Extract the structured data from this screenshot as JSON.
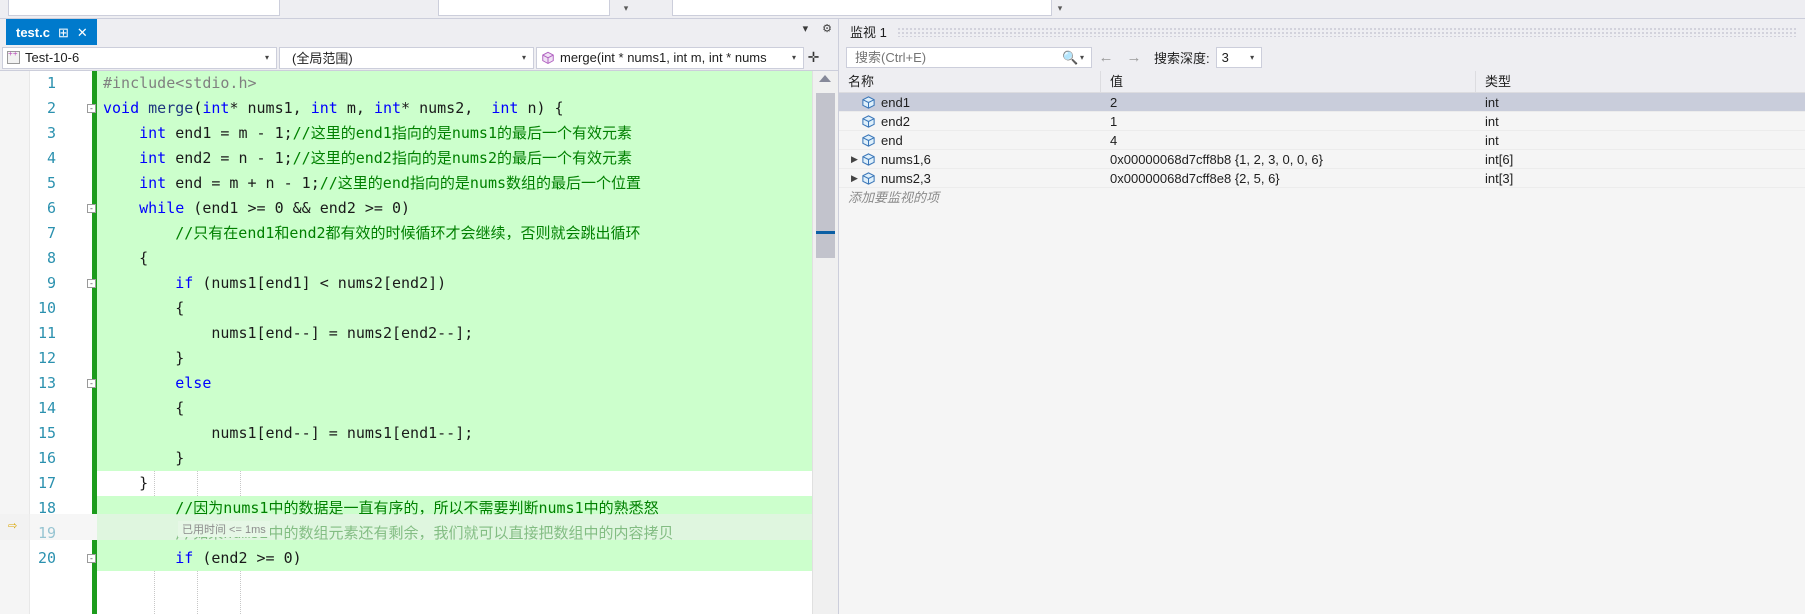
{
  "window": {
    "editor_tab": {
      "title": "test.c",
      "pin": "⊞",
      "close": "✕"
    },
    "tab_controls": {
      "dropdown": "▾",
      "settings": "⚙"
    }
  },
  "navbar": {
    "project_combo": {
      "value": "Test-10-6",
      "arrow": "▾",
      "icon": "project-icon"
    },
    "scope_combo": {
      "value": "(全局范围)",
      "arrow": "▾"
    },
    "member_combo": {
      "value": "merge(int * nums1, int m, int * nums",
      "arrow": "▾",
      "icon": "method-cube-icon"
    },
    "split_button": "✛"
  },
  "editor": {
    "execution_tooltip": "已用时间 <= 1ms",
    "current_line_marker": "⇨",
    "lines": [
      {
        "n": "1",
        "fold": "",
        "highlight": true,
        "tokens": [
          {
            "t": "#include<stdio.h>",
            "c": "pp"
          }
        ]
      },
      {
        "n": "2",
        "fold": "-",
        "highlight": true,
        "tokens": [
          {
            "t": "void",
            "c": "kw"
          },
          {
            "t": " ",
            "c": "op"
          },
          {
            "t": "merge",
            "c": "idn"
          },
          {
            "t": "(",
            "c": "brk"
          },
          {
            "t": "int",
            "c": "kw"
          },
          {
            "t": "* nums1, ",
            "c": "op"
          },
          {
            "t": "int",
            "c": "kw"
          },
          {
            "t": " m, ",
            "c": "op"
          },
          {
            "t": "int",
            "c": "kw"
          },
          {
            "t": "* nums2,  ",
            "c": "op"
          },
          {
            "t": "int",
            "c": "kw"
          },
          {
            "t": " n) {",
            "c": "op"
          }
        ]
      },
      {
        "n": "3",
        "fold": "",
        "highlight": true,
        "tokens": [
          {
            "t": "    ",
            "c": "op"
          },
          {
            "t": "int",
            "c": "kw"
          },
          {
            "t": " end1 = m - 1;",
            "c": "op"
          },
          {
            "t": "//这里的end1指向的是nums1的最后一个有效元素",
            "c": "cmt"
          }
        ]
      },
      {
        "n": "4",
        "fold": "",
        "highlight": true,
        "tokens": [
          {
            "t": "    ",
            "c": "op"
          },
          {
            "t": "int",
            "c": "kw"
          },
          {
            "t": " end2 = n - 1;",
            "c": "op"
          },
          {
            "t": "//这里的end2指向的是nums2的最后一个有效元素",
            "c": "cmt"
          }
        ]
      },
      {
        "n": "5",
        "fold": "",
        "highlight": true,
        "tokens": [
          {
            "t": "    ",
            "c": "op"
          },
          {
            "t": "int",
            "c": "kw"
          },
          {
            "t": " end = m + n - 1;",
            "c": "op"
          },
          {
            "t": "//这里的end指向的是nums数组的最后一个位置",
            "c": "cmt"
          }
        ]
      },
      {
        "n": "6",
        "fold": "-",
        "highlight": true,
        "tokens": [
          {
            "t": "    ",
            "c": "op"
          },
          {
            "t": "while",
            "c": "kw"
          },
          {
            "t": " (end1 >= 0 && end2 >= 0)",
            "c": "op"
          }
        ]
      },
      {
        "n": "7",
        "fold": "",
        "highlight": true,
        "tokens": [
          {
            "t": "        ",
            "c": "op"
          },
          {
            "t": "//只有在end1和end2都有效的时候循环才会继续，否则就会跳出循环",
            "c": "cmt"
          }
        ]
      },
      {
        "n": "8",
        "fold": "",
        "highlight": true,
        "tokens": [
          {
            "t": "    {",
            "c": "op"
          }
        ]
      },
      {
        "n": "9",
        "fold": "-",
        "highlight": true,
        "tokens": [
          {
            "t": "        ",
            "c": "op"
          },
          {
            "t": "if",
            "c": "kw"
          },
          {
            "t": " (nums1[end1] < nums2[end2])",
            "c": "op"
          }
        ]
      },
      {
        "n": "10",
        "fold": "",
        "highlight": true,
        "tokens": [
          {
            "t": "        {",
            "c": "op"
          }
        ]
      },
      {
        "n": "11",
        "fold": "",
        "highlight": true,
        "tokens": [
          {
            "t": "            nums1[end--] = nums2[end2--];",
            "c": "op"
          }
        ]
      },
      {
        "n": "12",
        "fold": "",
        "highlight": true,
        "tokens": [
          {
            "t": "        }",
            "c": "op"
          }
        ]
      },
      {
        "n": "13",
        "fold": "-",
        "highlight": true,
        "tokens": [
          {
            "t": "        ",
            "c": "op"
          },
          {
            "t": "else",
            "c": "kw"
          }
        ]
      },
      {
        "n": "14",
        "fold": "",
        "highlight": true,
        "tokens": [
          {
            "t": "        {",
            "c": "op"
          }
        ]
      },
      {
        "n": "15",
        "fold": "",
        "highlight": true,
        "tokens": [
          {
            "t": "            nums1[end--] = nums1[end1--];",
            "c": "op"
          }
        ]
      },
      {
        "n": "16",
        "fold": "",
        "highlight": true,
        "tokens": [
          {
            "t": "        }",
            "c": "op"
          }
        ]
      },
      {
        "n": "17",
        "fold": "",
        "highlight": false,
        "tokens": [
          {
            "t": "    }",
            "c": "op"
          }
        ]
      },
      {
        "n": "18",
        "fold": "",
        "highlight": true,
        "tokens": [
          {
            "t": "        ",
            "c": "op"
          },
          {
            "t": "//因为nums1中的数据是一直有序的，所以不需要判断nums1中的熟悉怒",
            "c": "cmt"
          }
        ]
      },
      {
        "n": "19",
        "fold": "",
        "highlight": true,
        "tokens": [
          {
            "t": "        ",
            "c": "op"
          },
          {
            "t": "//如果nums2中的数组元素还有剩余，我们就可以直接把数组中的内容拷贝",
            "c": "cmt"
          }
        ]
      },
      {
        "n": "20",
        "fold": "-",
        "highlight": true,
        "tokens": [
          {
            "t": "        ",
            "c": "op"
          },
          {
            "t": "if",
            "c": "kw"
          },
          {
            "t": " (end2 >= 0)",
            "c": "op"
          }
        ]
      }
    ]
  },
  "watch": {
    "panel_title": "监视 1",
    "search": {
      "placeholder": "搜索(Ctrl+E)",
      "value": "",
      "icon": "search-icon",
      "dropdown_icon": "▾"
    },
    "nav_back": "←",
    "nav_forward": "→",
    "depth_label": "搜索深度:",
    "depth_value": "3",
    "depth_arrow": "▾",
    "columns": [
      "名称",
      "值",
      "类型"
    ],
    "rows": [
      {
        "name": "end1",
        "value": "2",
        "type": "int",
        "expandable": false,
        "selected": true
      },
      {
        "name": "end2",
        "value": "1",
        "type": "int",
        "expandable": false,
        "selected": false
      },
      {
        "name": "end",
        "value": "4",
        "type": "int",
        "expandable": false,
        "selected": false
      },
      {
        "name": "nums1,6",
        "value": "0x00000068d7cff8b8 {1, 2, 3, 0, 0, 6}",
        "type": "int[6]",
        "expandable": true,
        "selected": false
      },
      {
        "name": "nums2,3",
        "value": "0x00000068d7cff8e8 {2, 5, 6}",
        "type": "int[3]",
        "expandable": true,
        "selected": false
      }
    ],
    "add_item_placeholder": "添加要监视的项"
  },
  "colors": {
    "tab_active": "#007acc",
    "highlight_line": "#ccffcc",
    "selection": "#c9cddb",
    "changebar": "#1c9c1c",
    "comment": "#008000",
    "keyword": "#0000ff",
    "linenumber": "#2b91af",
    "chrome": "#eeeef2"
  }
}
